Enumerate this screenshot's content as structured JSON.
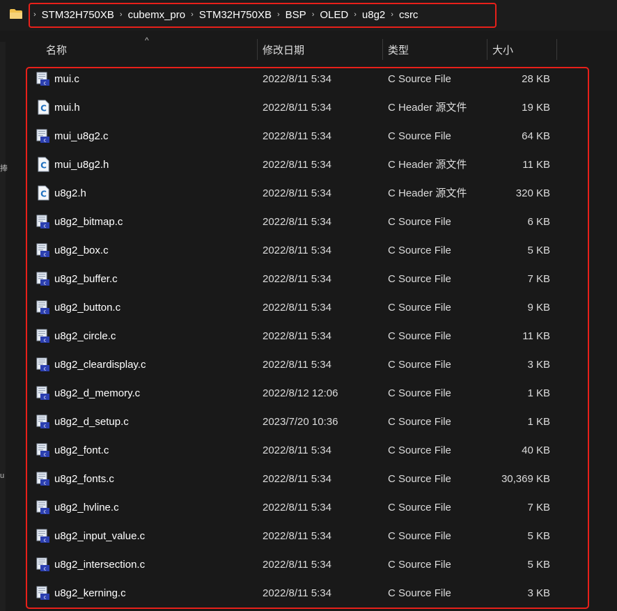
{
  "breadcrumb": [
    "STM32H750XB",
    "cubemx_pro",
    "STM32H750XB",
    "BSP",
    "OLED",
    "u8g2",
    "csrc"
  ],
  "columns": {
    "name": "名称",
    "date": "修改日期",
    "type": "类型",
    "size": "大小"
  },
  "nav_glyphs": [
    "捧",
    "u"
  ],
  "files": [
    {
      "name": "mui.c",
      "date": "2022/8/11 5:34",
      "type": "C Source File",
      "size": "28 KB",
      "icon": "c-source-icon"
    },
    {
      "name": "mui.h",
      "date": "2022/8/11 5:34",
      "type": "C Header 源文件",
      "size": "19 KB",
      "icon": "c-header-icon"
    },
    {
      "name": "mui_u8g2.c",
      "date": "2022/8/11 5:34",
      "type": "C Source File",
      "size": "64 KB",
      "icon": "c-source-icon"
    },
    {
      "name": "mui_u8g2.h",
      "date": "2022/8/11 5:34",
      "type": "C Header 源文件",
      "size": "11 KB",
      "icon": "c-header-icon"
    },
    {
      "name": "u8g2.h",
      "date": "2022/8/11 5:34",
      "type": "C Header 源文件",
      "size": "320 KB",
      "icon": "c-header-icon"
    },
    {
      "name": "u8g2_bitmap.c",
      "date": "2022/8/11 5:34",
      "type": "C Source File",
      "size": "6 KB",
      "icon": "c-source-icon"
    },
    {
      "name": "u8g2_box.c",
      "date": "2022/8/11 5:34",
      "type": "C Source File",
      "size": "5 KB",
      "icon": "c-source-icon"
    },
    {
      "name": "u8g2_buffer.c",
      "date": "2022/8/11 5:34",
      "type": "C Source File",
      "size": "7 KB",
      "icon": "c-source-icon"
    },
    {
      "name": "u8g2_button.c",
      "date": "2022/8/11 5:34",
      "type": "C Source File",
      "size": "9 KB",
      "icon": "c-source-icon"
    },
    {
      "name": "u8g2_circle.c",
      "date": "2022/8/11 5:34",
      "type": "C Source File",
      "size": "11 KB",
      "icon": "c-source-icon"
    },
    {
      "name": "u8g2_cleardisplay.c",
      "date": "2022/8/11 5:34",
      "type": "C Source File",
      "size": "3 KB",
      "icon": "c-source-icon"
    },
    {
      "name": "u8g2_d_memory.c",
      "date": "2022/8/12 12:06",
      "type": "C Source File",
      "size": "1 KB",
      "icon": "c-source-icon"
    },
    {
      "name": "u8g2_d_setup.c",
      "date": "2023/7/20 10:36",
      "type": "C Source File",
      "size": "1 KB",
      "icon": "c-source-icon"
    },
    {
      "name": "u8g2_font.c",
      "date": "2022/8/11 5:34",
      "type": "C Source File",
      "size": "40 KB",
      "icon": "c-source-icon"
    },
    {
      "name": "u8g2_fonts.c",
      "date": "2022/8/11 5:34",
      "type": "C Source File",
      "size": "30,369 KB",
      "icon": "c-source-icon"
    },
    {
      "name": "u8g2_hvline.c",
      "date": "2022/8/11 5:34",
      "type": "C Source File",
      "size": "7 KB",
      "icon": "c-source-icon"
    },
    {
      "name": "u8g2_input_value.c",
      "date": "2022/8/11 5:34",
      "type": "C Source File",
      "size": "5 KB",
      "icon": "c-source-icon"
    },
    {
      "name": "u8g2_intersection.c",
      "date": "2022/8/11 5:34",
      "type": "C Source File",
      "size": "5 KB",
      "icon": "c-source-icon"
    },
    {
      "name": "u8g2_kerning.c",
      "date": "2022/8/11 5:34",
      "type": "C Source File",
      "size": "3 KB",
      "icon": "c-source-icon"
    }
  ],
  "colors": {
    "background": "#191919",
    "highlight": "#e8201a",
    "folder": "#f2c14e"
  }
}
